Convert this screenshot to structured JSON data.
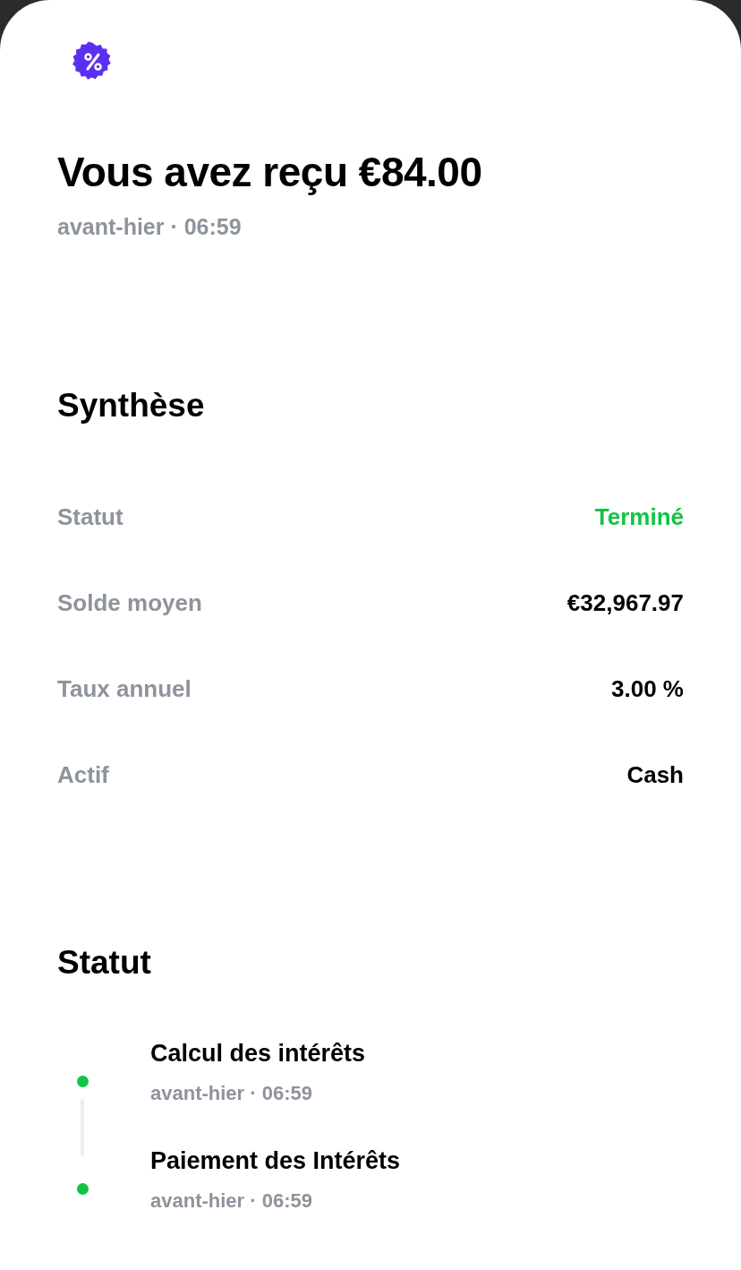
{
  "header": {
    "title": "Vous avez reçu €84.00",
    "subtitle": "avant-hier · 06:59"
  },
  "summary": {
    "title": "Synthèse",
    "rows": [
      {
        "label": "Statut",
        "value": "Terminé",
        "kind": "status"
      },
      {
        "label": "Solde moyen",
        "value": "€32,967.97",
        "kind": "text"
      },
      {
        "label": "Taux annuel",
        "value": "3.00 %",
        "kind": "text"
      },
      {
        "label": "Actif",
        "value": "Cash",
        "kind": "text"
      }
    ]
  },
  "status": {
    "title": "Statut",
    "steps": [
      {
        "title": "Calcul des intérêts",
        "time": "avant-hier · 06:59",
        "done": true
      },
      {
        "title": "Paiement des Intérêts",
        "time": "avant-hier · 06:59",
        "done": true
      }
    ]
  }
}
